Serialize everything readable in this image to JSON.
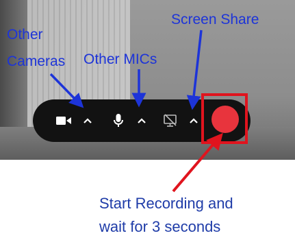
{
  "annotations": {
    "other_cameras_line1": "Other",
    "other_cameras_line2": "Cameras",
    "other_mics": "Other MICs",
    "screen_share": "Screen Share",
    "start_recording_line1": "Start Recording and",
    "start_recording_line2": "wait for 3 seconds"
  },
  "controls": [
    {
      "icon": "video-camera-icon"
    },
    {
      "icon": "chevron-up-icon"
    },
    {
      "icon": "microphone-icon"
    },
    {
      "icon": "chevron-up-icon"
    },
    {
      "icon": "screen-share-off-icon"
    },
    {
      "icon": "chevron-up-icon"
    },
    {
      "icon": "record-icon"
    }
  ],
  "colors": {
    "annotation_blue": "#1d34d8",
    "bottom_text_blue": "#1f3ca8",
    "record_red": "#e8343d",
    "highlight_red": "#e0141e",
    "bar_background": "#121212"
  }
}
